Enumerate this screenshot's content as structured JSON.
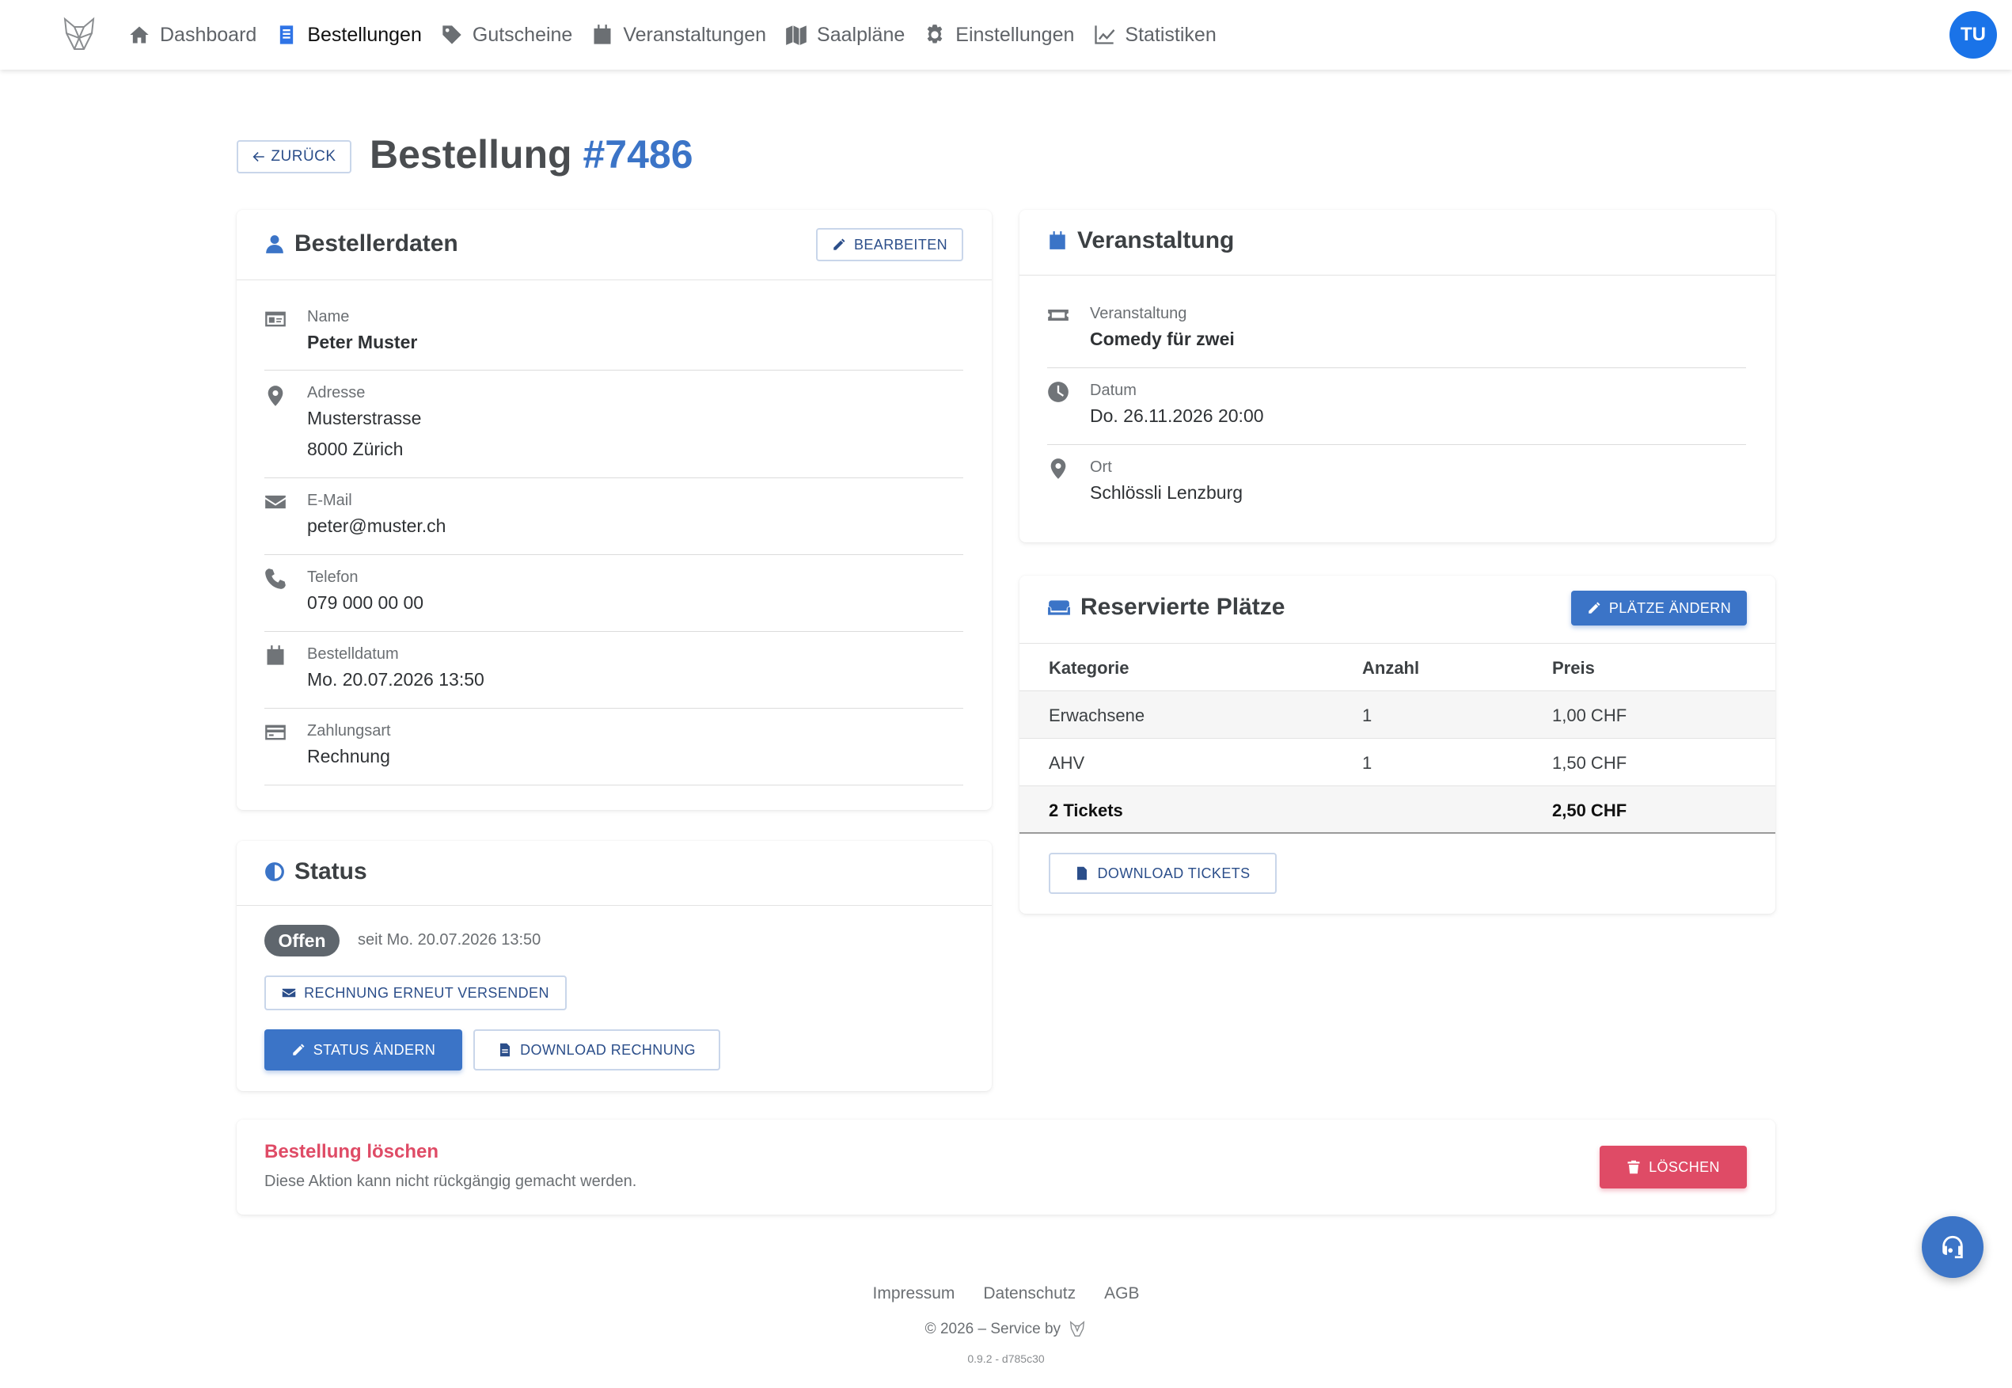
{
  "nav": {
    "items": [
      {
        "label": "Dashboard",
        "icon": "home-icon"
      },
      {
        "label": "Bestellungen",
        "icon": "document-icon"
      },
      {
        "label": "Gutscheine",
        "icon": "tag-icon"
      },
      {
        "label": "Veranstaltungen",
        "icon": "calendar-icon"
      },
      {
        "label": "Saalpläne",
        "icon": "map-icon"
      },
      {
        "label": "Einstellungen",
        "icon": "gear-icon"
      },
      {
        "label": "Statistiken",
        "icon": "chart-line-icon"
      }
    ],
    "active": "Bestellungen",
    "avatar": "TU"
  },
  "header": {
    "back_label": "ZURÜCK",
    "title_prefix": "Bestellung",
    "order_number": "#7486"
  },
  "customer": {
    "title": "Bestellerdaten",
    "edit_label": "BEARBEITEN",
    "fields": [
      {
        "label": "Name",
        "value": "Peter Muster",
        "value2": ""
      },
      {
        "label": "Adresse",
        "value": "Musterstrasse",
        "value2": "8000 Zürich"
      },
      {
        "label": "E-Mail",
        "value": "peter@muster.ch",
        "value2": ""
      },
      {
        "label": "Telefon",
        "value": "079 000 00 00",
        "value2": ""
      },
      {
        "label": "Bestelldatum",
        "value": "Mo. 20.07.2026 13:50",
        "value2": ""
      },
      {
        "label": "Zahlungsart",
        "value": "Rechnung",
        "value2": ""
      }
    ]
  },
  "event": {
    "title": "Veranstaltung",
    "fields": [
      {
        "label": "Veranstaltung",
        "value": "Comedy für zwei"
      },
      {
        "label": "Datum",
        "value": "Do. 26.11.2026 20:00"
      },
      {
        "label": "Ort",
        "value": "Schlössli Lenzburg"
      }
    ]
  },
  "seats": {
    "title": "Reservierte Plätze",
    "change_label": "PLÄTZE ÄNDERN",
    "columns": [
      "Kategorie",
      "Anzahl",
      "Preis"
    ],
    "rows": [
      {
        "category": "Erwachsene",
        "count": "1",
        "price": "1,00 CHF"
      },
      {
        "category": "AHV",
        "count": "1",
        "price": "1,50 CHF"
      }
    ],
    "total": {
      "label": "2 Tickets",
      "price": "2,50 CHF"
    },
    "download_label": "DOWNLOAD TICKETS"
  },
  "status": {
    "title": "Status",
    "badge": "Offen",
    "since": "seit Mo. 20.07.2026 13:50",
    "resend_label": "RECHNUNG ERNEUT VERSENDEN",
    "change_label": "STATUS ÄNDERN",
    "download_label": "DOWNLOAD RECHNUNG"
  },
  "delete": {
    "title": "Bestellung löschen",
    "description": "Diese Aktion kann nicht rückgängig gemacht werden.",
    "button_label": "LÖSCHEN",
    "color": "#df4b66"
  },
  "footer": {
    "links": [
      "Impressum",
      "Datenschutz",
      "AGB"
    ],
    "copyright": "© 2026 – Service by",
    "version": "0.9.2 - d785c30"
  },
  "colors": {
    "accent": "#3b74c7",
    "nav_active": "#1a73e8",
    "badge": "#5f666d"
  }
}
